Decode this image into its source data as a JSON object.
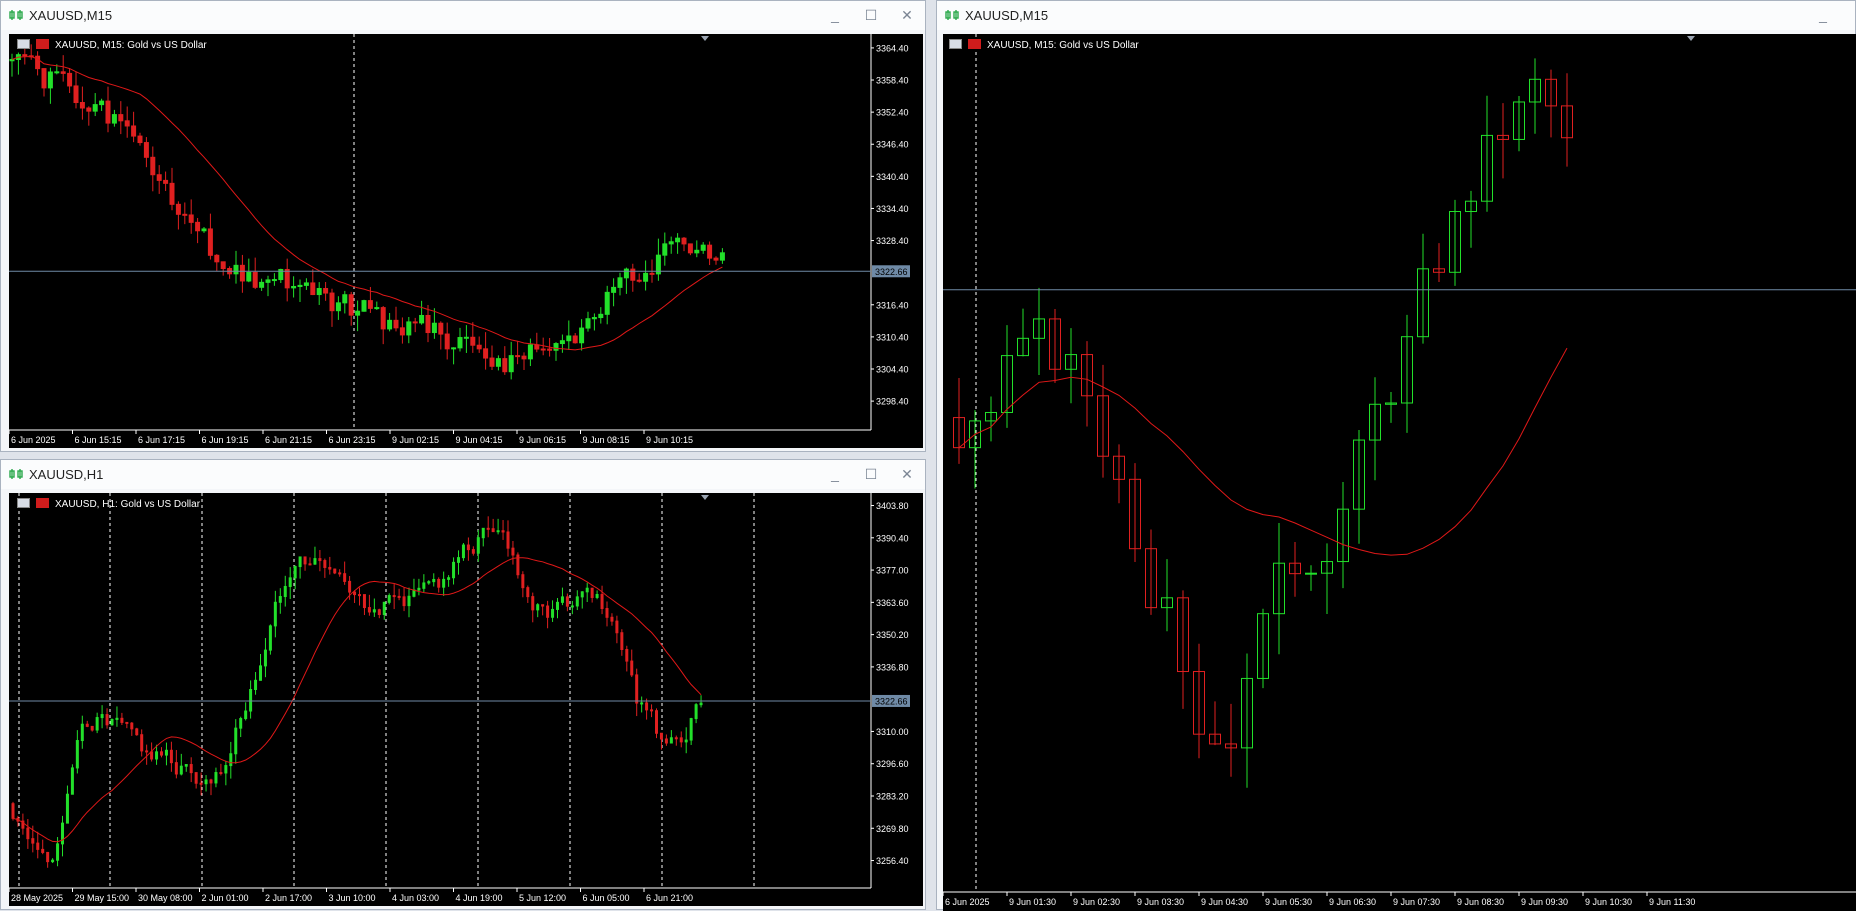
{
  "colors": {
    "bull": "#22e02a",
    "bear": "#e02020",
    "ma": "#e01818",
    "grid": "#ffffff",
    "axis": "#ffffff",
    "price_line": "#6f8aa6",
    "bg": "#000000"
  },
  "windows": [
    {
      "title": "XAUUSD,M15",
      "has_min": true,
      "has_max": true,
      "has_close": true
    },
    {
      "title": "XAUUSD,H1",
      "has_min": true,
      "has_max": true,
      "has_close": true
    },
    {
      "title": "XAUUSD,M15",
      "has_min": true,
      "has_max": false,
      "has_close": false
    }
  ],
  "charts": [
    {
      "label": "XAUUSD, M15:  Gold vs US Dollar",
      "price_tag": "3322.66",
      "y_ticks": [
        "3364.40",
        "3358.40",
        "3352.40",
        "3346.40",
        "3340.40",
        "3334.40",
        "3328.40",
        "3322.66",
        "3316.40",
        "3310.40",
        "3304.40",
        "3298.40"
      ],
      "x_ticks": [
        "6 Jun 2025",
        "6 Jun 15:15",
        "6 Jun 17:15",
        "6 Jun 19:15",
        "6 Jun 21:15",
        "6 Jun 23:15",
        "9 Jun 02:15",
        "9 Jun 04:15",
        "9 Jun 06:15",
        "9 Jun 08:15",
        "9 Jun 10:15"
      ],
      "chart_data": {
        "type": "candlestick",
        "ylim": [
          3293,
          3367
        ],
        "current": 3322.66,
        "ma_period": 21,
        "seed": 1
      }
    },
    {
      "label": "XAUUSD, H1:  Gold vs US Dollar",
      "price_tag": "3322.66",
      "y_ticks": [
        "3403.80",
        "3390.40",
        "3377.00",
        "3363.60",
        "3350.20",
        "3336.80",
        "3322.66",
        "3310.00",
        "3296.60",
        "3283.20",
        "3269.80",
        "3256.40"
      ],
      "x_ticks": [
        "28 May 2025",
        "29 May 15:00",
        "30 May 08:00",
        "2 Jun 01:00",
        "2 Jun 17:00",
        "3 Jun 10:00",
        "4 Jun 03:00",
        "4 Jun 19:00",
        "5 Jun 12:00",
        "6 Jun 05:00",
        "6 Jun 21:00"
      ],
      "chart_data": {
        "type": "candlestick",
        "ylim": [
          3245,
          3409
        ],
        "current": 3322.66,
        "ma_period": 21,
        "seed": 2
      }
    },
    {
      "label": "XAUUSD, M15:  Gold vs US Dollar",
      "x_ticks": [
        "6 Jun 2025",
        "9 Jun 01:30",
        "9 Jun 02:30",
        "9 Jun 03:30",
        "9 Jun 04:30",
        "9 Jun 05:30",
        "9 Jun 06:30",
        "9 Jun 07:30",
        "9 Jun 08:30",
        "9 Jun 09:30",
        "9 Jun 10:30",
        "9 Jun 11:30"
      ],
      "chart_data": {
        "type": "candlestick",
        "current": 3322.66,
        "ma_period": 21,
        "seed": 3
      }
    }
  ]
}
